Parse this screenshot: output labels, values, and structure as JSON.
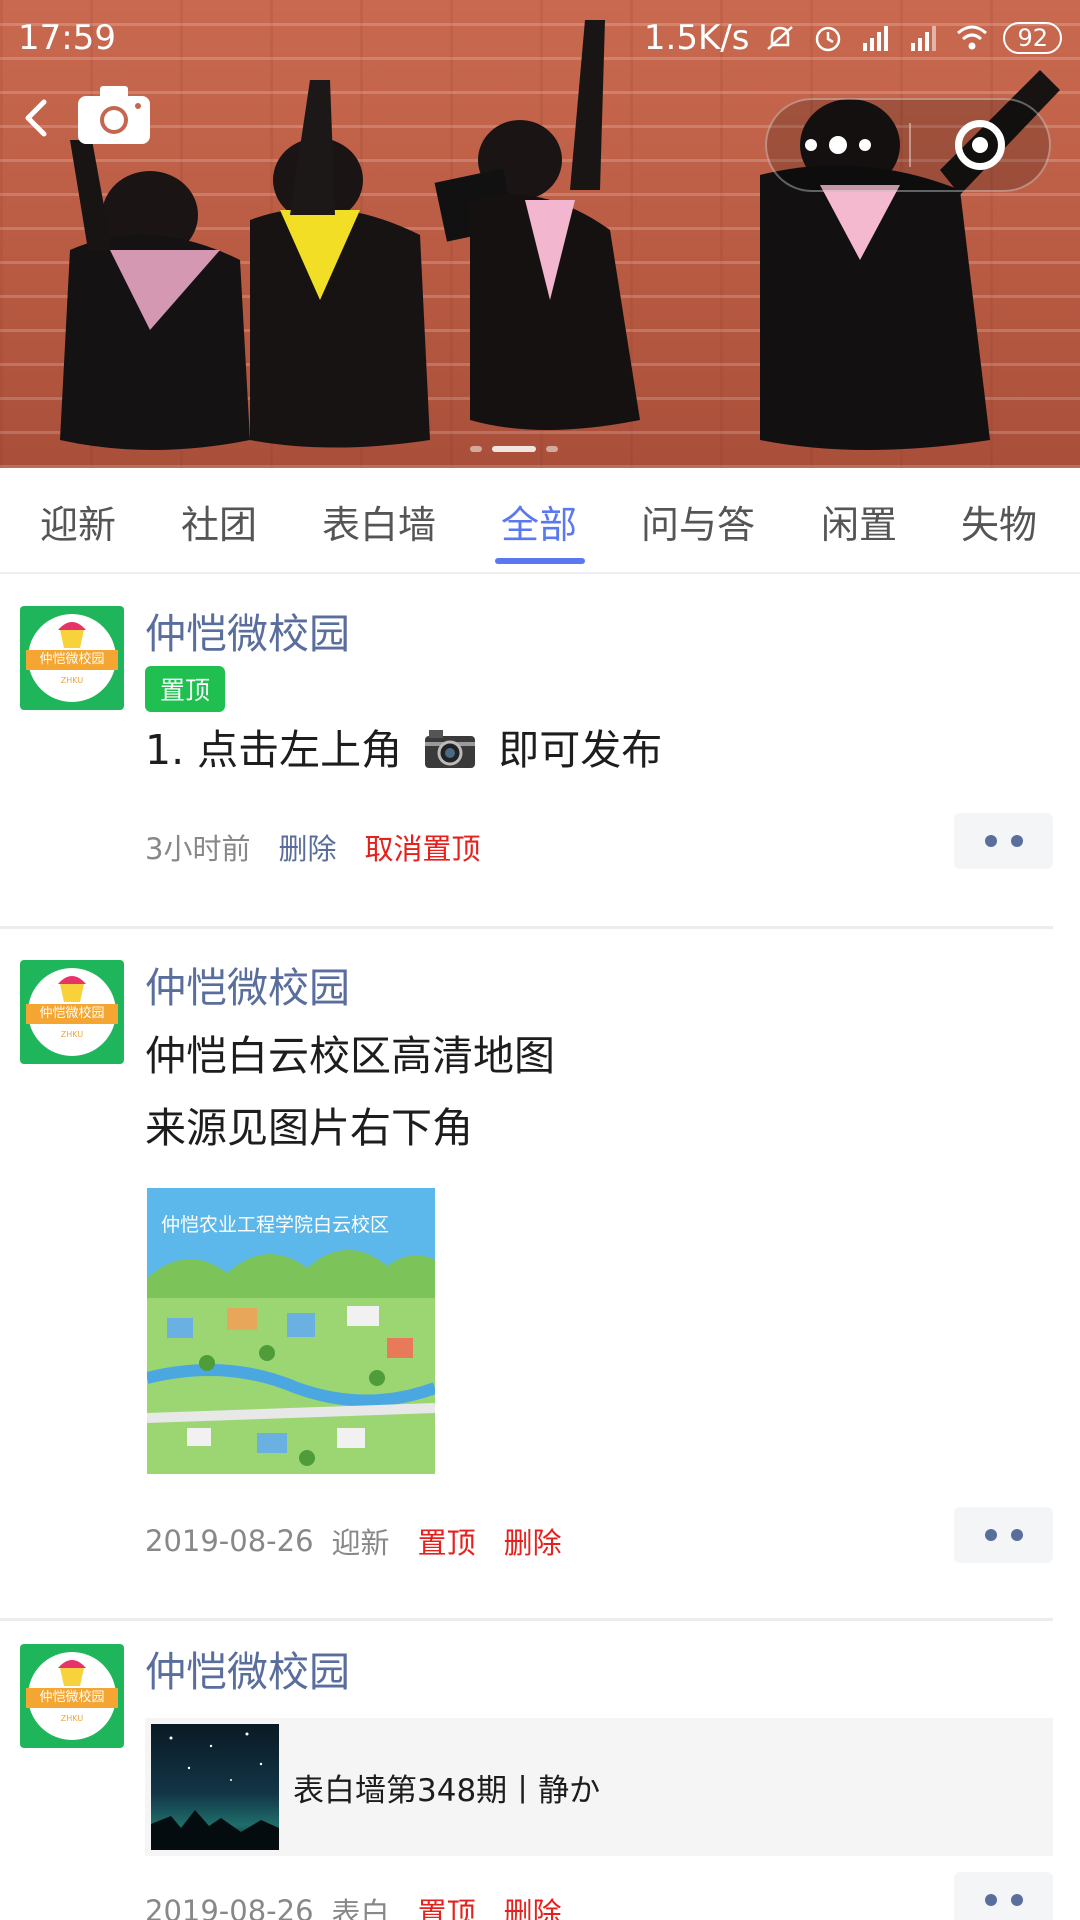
{
  "status_bar": {
    "time": "17:59",
    "net_speed": "1.5K/s",
    "battery": "92",
    "icons": [
      "mute-bell-icon",
      "alarm-icon",
      "signal-icon",
      "signal-icon",
      "wifi-icon",
      "battery-icon"
    ]
  },
  "header": {
    "back_icon": "back-arrow-icon",
    "camera_icon": "camera-icon",
    "capsule": {
      "more_icon": "more-dots-icon",
      "close_icon": "target-close-icon"
    }
  },
  "banner": {
    "slide_count": 3,
    "active_slide": 2
  },
  "tabs": [
    {
      "label": "迎新",
      "active": false
    },
    {
      "label": "社团",
      "active": false
    },
    {
      "label": "表白墙",
      "active": false
    },
    {
      "label": "全部",
      "active": true
    },
    {
      "label": "问与答",
      "active": false
    },
    {
      "label": "闲置",
      "active": false
    },
    {
      "label": "失物",
      "active": false
    }
  ],
  "accent_color": "#5b78f0",
  "posts": [
    {
      "author": "仲恺微校园",
      "avatar_text": "仲恺微校园",
      "avatar_subtext": "ZHKU",
      "badge": "置顶",
      "text_before_icon": "1. 点击左上角",
      "text_after_icon": "即可发布",
      "inline_icon": "camera-emoji-icon",
      "time": "3小时前",
      "actions": [
        "删除",
        "取消置顶"
      ]
    },
    {
      "author": "仲恺微校园",
      "avatar_text": "仲恺微校园",
      "avatar_subtext": "ZHKU",
      "lines": [
        "仲恺白云校区高清地图",
        "来源见图片右下角"
      ],
      "image_caption": "仲恺农业工程学院白云校区",
      "time": "2019-08-26",
      "category": "迎新",
      "actions": [
        "置顶",
        "删除"
      ]
    },
    {
      "author": "仲恺微校园",
      "avatar_text": "仲恺微校园",
      "avatar_subtext": "ZHKU",
      "article_title": "表白墙第348期丨静か",
      "time": "2019-08-26",
      "category": "表白",
      "actions": [
        "置顶",
        "删除"
      ]
    }
  ]
}
